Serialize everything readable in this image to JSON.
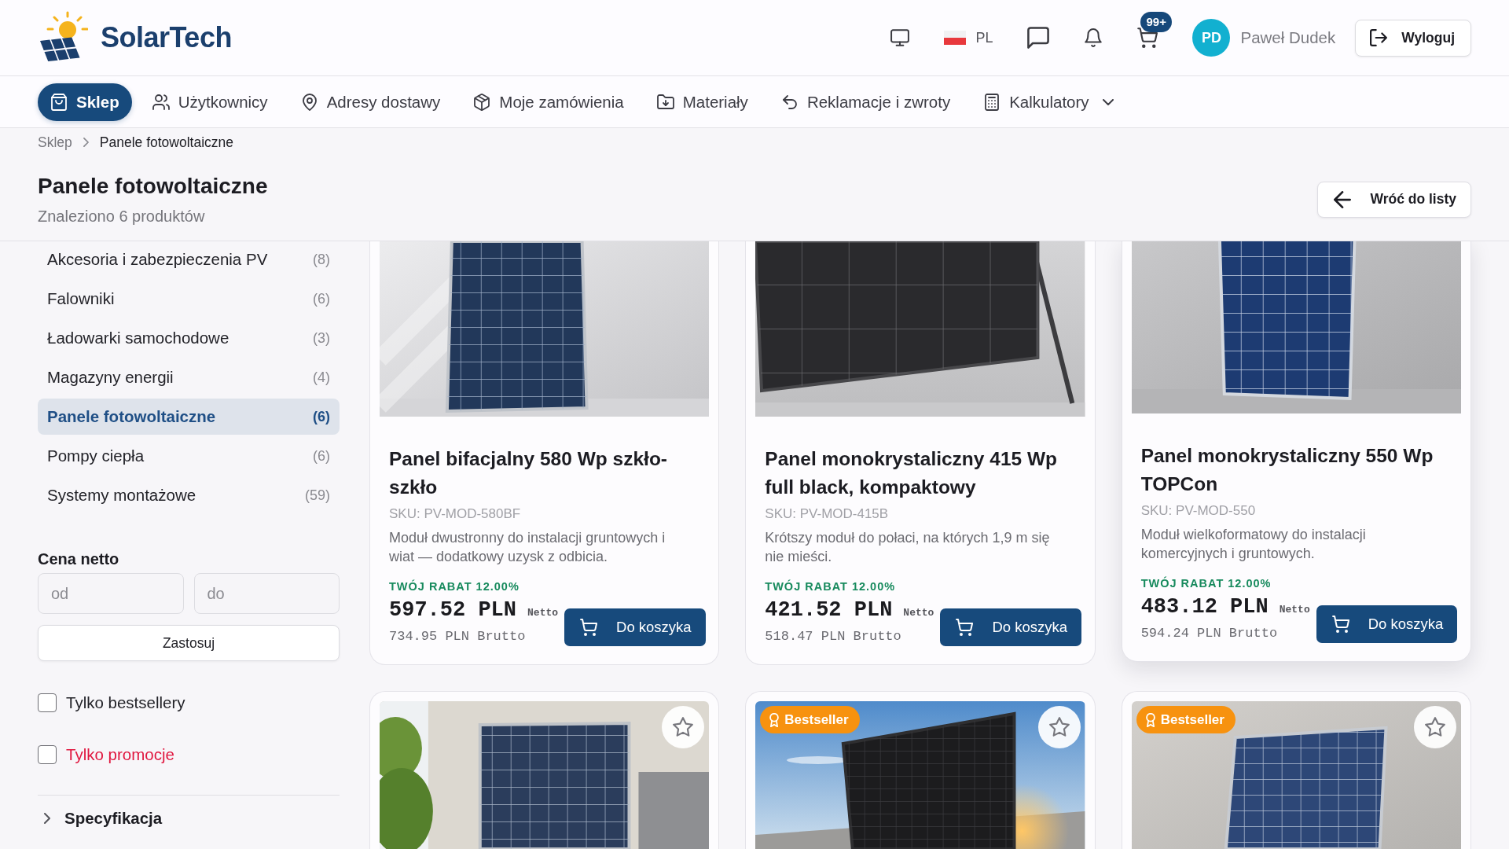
{
  "topbar": {
    "logo": "SolarTech",
    "language": "PL",
    "cart_badge": "99+",
    "user": {
      "initials": "PD",
      "name": "Paweł Dudek"
    },
    "logout": "Wyloguj"
  },
  "nav": [
    {
      "label": "Sklep",
      "selected": true,
      "kind": "link"
    },
    {
      "label": "Użytkownicy",
      "selected": false,
      "kind": "link"
    },
    {
      "label": "Adresy dostawy",
      "selected": false,
      "kind": "link"
    },
    {
      "label": "Moje zamówienia",
      "selected": false,
      "kind": "link"
    },
    {
      "label": "Materiały",
      "selected": false,
      "kind": "link"
    },
    {
      "label": "Reklamacje i zwroty",
      "selected": false,
      "kind": "link"
    },
    {
      "label": "Kalkulatory",
      "selected": false,
      "kind": "dropdown"
    }
  ],
  "breadcrumb": [
    {
      "label": "Sklep",
      "current": false
    },
    {
      "label": "Panele fotowoltaiczne",
      "current": true
    }
  ],
  "page_header": {
    "title": "Panele fotowoltaiczne",
    "subtitle": "Znaleziono 6 produktów",
    "back_button": "Wróć do listy"
  },
  "sidebar": {
    "categories": [
      {
        "name": "Akcesoria i zabezpieczenia PV",
        "count": "(8)",
        "selected": false
      },
      {
        "name": "Falowniki",
        "count": "(6)",
        "selected": false
      },
      {
        "name": "Ładowarki samochodowe",
        "count": "(3)",
        "selected": false
      },
      {
        "name": "Magazyny energii",
        "count": "(4)",
        "selected": false
      },
      {
        "name": "Panele fotowoltaiczne",
        "count": "(6)",
        "selected": true
      },
      {
        "name": "Pompy ciepła",
        "count": "(6)",
        "selected": false
      },
      {
        "name": "Systemy montażowe",
        "count": "(59)",
        "selected": false
      }
    ],
    "price_filter": {
      "title": "Cena netto",
      "from": {
        "placeholder": "od"
      },
      "to": {
        "placeholder": "do"
      },
      "apply_button": "Zastosuj"
    },
    "filters": [
      {
        "label": "Tylko bestsellery",
        "checked": false,
        "kind": "plain"
      },
      {
        "label": "Tylko promocje",
        "checked": false,
        "kind": "promo"
      }
    ],
    "sections": [
      {
        "label": "Specyfikacja",
        "expanded": false
      }
    ]
  },
  "products": [
    {
      "title": "Panel bifacjalny 580 Wp szkło-szkło",
      "sku": "SKU: PV-MOD-580BF",
      "description": "Moduł dwustronny do instalacji gruntowych i wiat — dodatkowy uzysk z odbicia.",
      "discount": "TWÓJ RABAT 12.00%",
      "price_net": "597.52 PLN",
      "net_label": "Netto",
      "price_gross": "734.95 PLN Brutto",
      "cart_button": "Do koszyka",
      "highlighted": false
    },
    {
      "title": "Panel monokrystaliczny 415 Wp full black, kompaktowy",
      "sku": "SKU: PV-MOD-415B",
      "description": "Krótszy moduł do połaci, na których 1,9 m się nie mieści.",
      "discount": "TWÓJ RABAT 12.00%",
      "price_net": "421.52 PLN",
      "net_label": "Netto",
      "price_gross": "518.47 PLN Brutto",
      "cart_button": "Do koszyka",
      "highlighted": false
    },
    {
      "title": "Panel monokrystaliczny 550 Wp TOPCon",
      "sku": "SKU: PV-MOD-550",
      "description": "Moduł wielkoformatowy do instalacji komercyjnych i gruntowych.",
      "discount": "TWÓJ RABAT 12.00%",
      "price_net": "483.12 PLN",
      "net_label": "Netto",
      "price_gross": "594.24 PLN Brutto",
      "cart_button": "Do koszyka",
      "highlighted": true
    },
    {
      "favorite": false,
      "highlighted": false
    },
    {
      "badge": "Bestseller",
      "favorite": false,
      "highlighted": false
    },
    {
      "badge": "Bestseller",
      "favorite": false,
      "highlighted": false
    }
  ]
}
